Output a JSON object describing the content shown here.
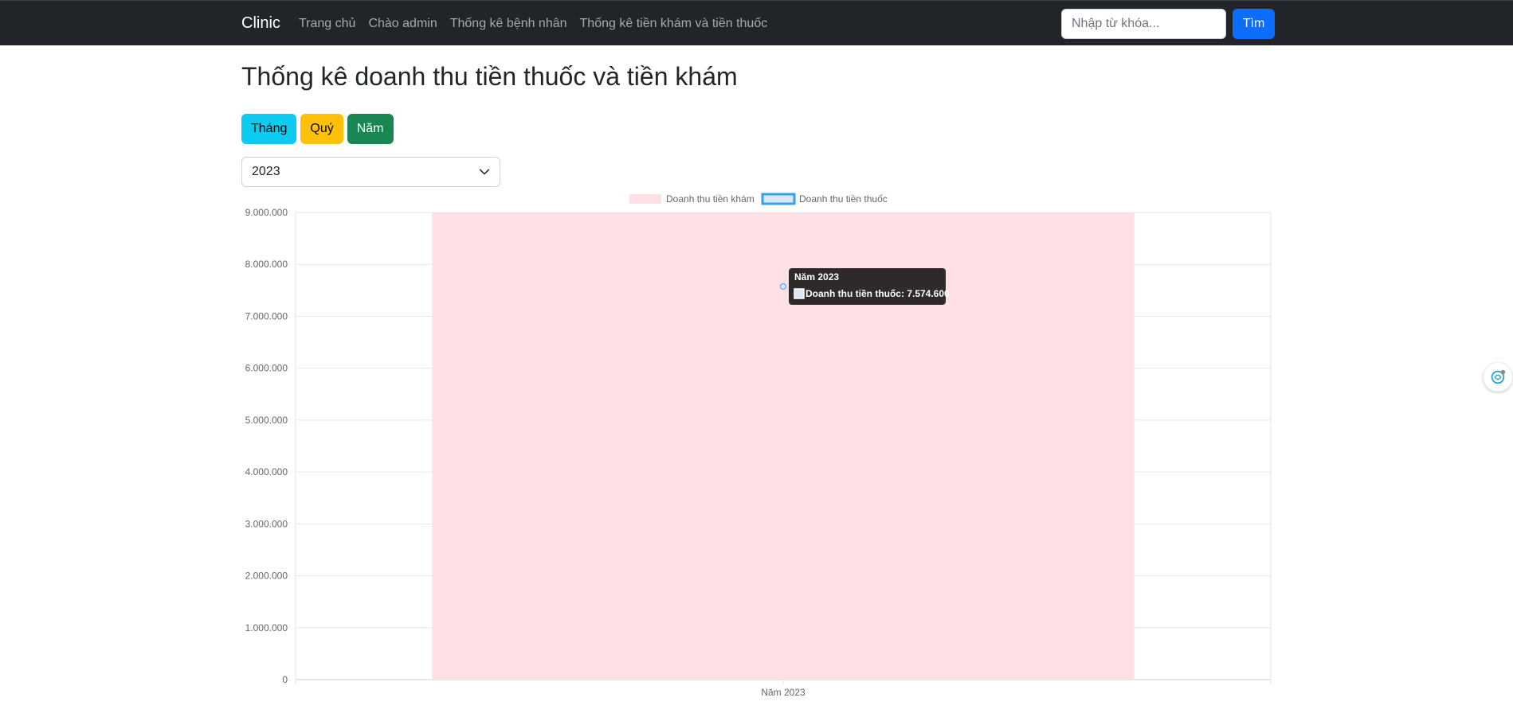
{
  "navbar": {
    "brand": "Clinic",
    "links": [
      "Trang chủ",
      "Chào admin",
      "Thống kê bệnh nhân",
      "Thống kê tiền khám và tiền thuốc"
    ],
    "search_placeholder": "Nhập từ khóa...",
    "search_button": "Tìm"
  },
  "page": {
    "title": "Thống kê doanh thu tiền thuốc và tiền khám",
    "period_buttons": {
      "month": "Tháng",
      "quarter": "Quý",
      "year": "Năm"
    },
    "year_select": {
      "selected": "2023"
    }
  },
  "colors": {
    "exam_fill": "#ffe0e6",
    "medicine_fill": "#dbe7f3",
    "medicine_border": "#36a2eb",
    "tooltip_bg": "#2e2a2a"
  },
  "chart_data": {
    "type": "bar",
    "categories": [
      "Năm 2023"
    ],
    "series": [
      {
        "name": "Doanh thu tiền khám",
        "values": [
          9000000
        ]
      },
      {
        "name": "Doanh thu tiền thuốc",
        "values": [
          7574600
        ]
      }
    ],
    "ylim": [
      0,
      9000000
    ],
    "yticks": [
      "0",
      "1.000.000",
      "2.000.000",
      "3.000.000",
      "4.000.000",
      "5.000.000",
      "6.000.000",
      "7.000.000",
      "8.000.000",
      "9.000.000"
    ],
    "legend": "top",
    "grid": true,
    "tooltip": {
      "title": "Năm 2023",
      "label": "Doanh thu tiền thuốc: 7.574.600"
    }
  }
}
